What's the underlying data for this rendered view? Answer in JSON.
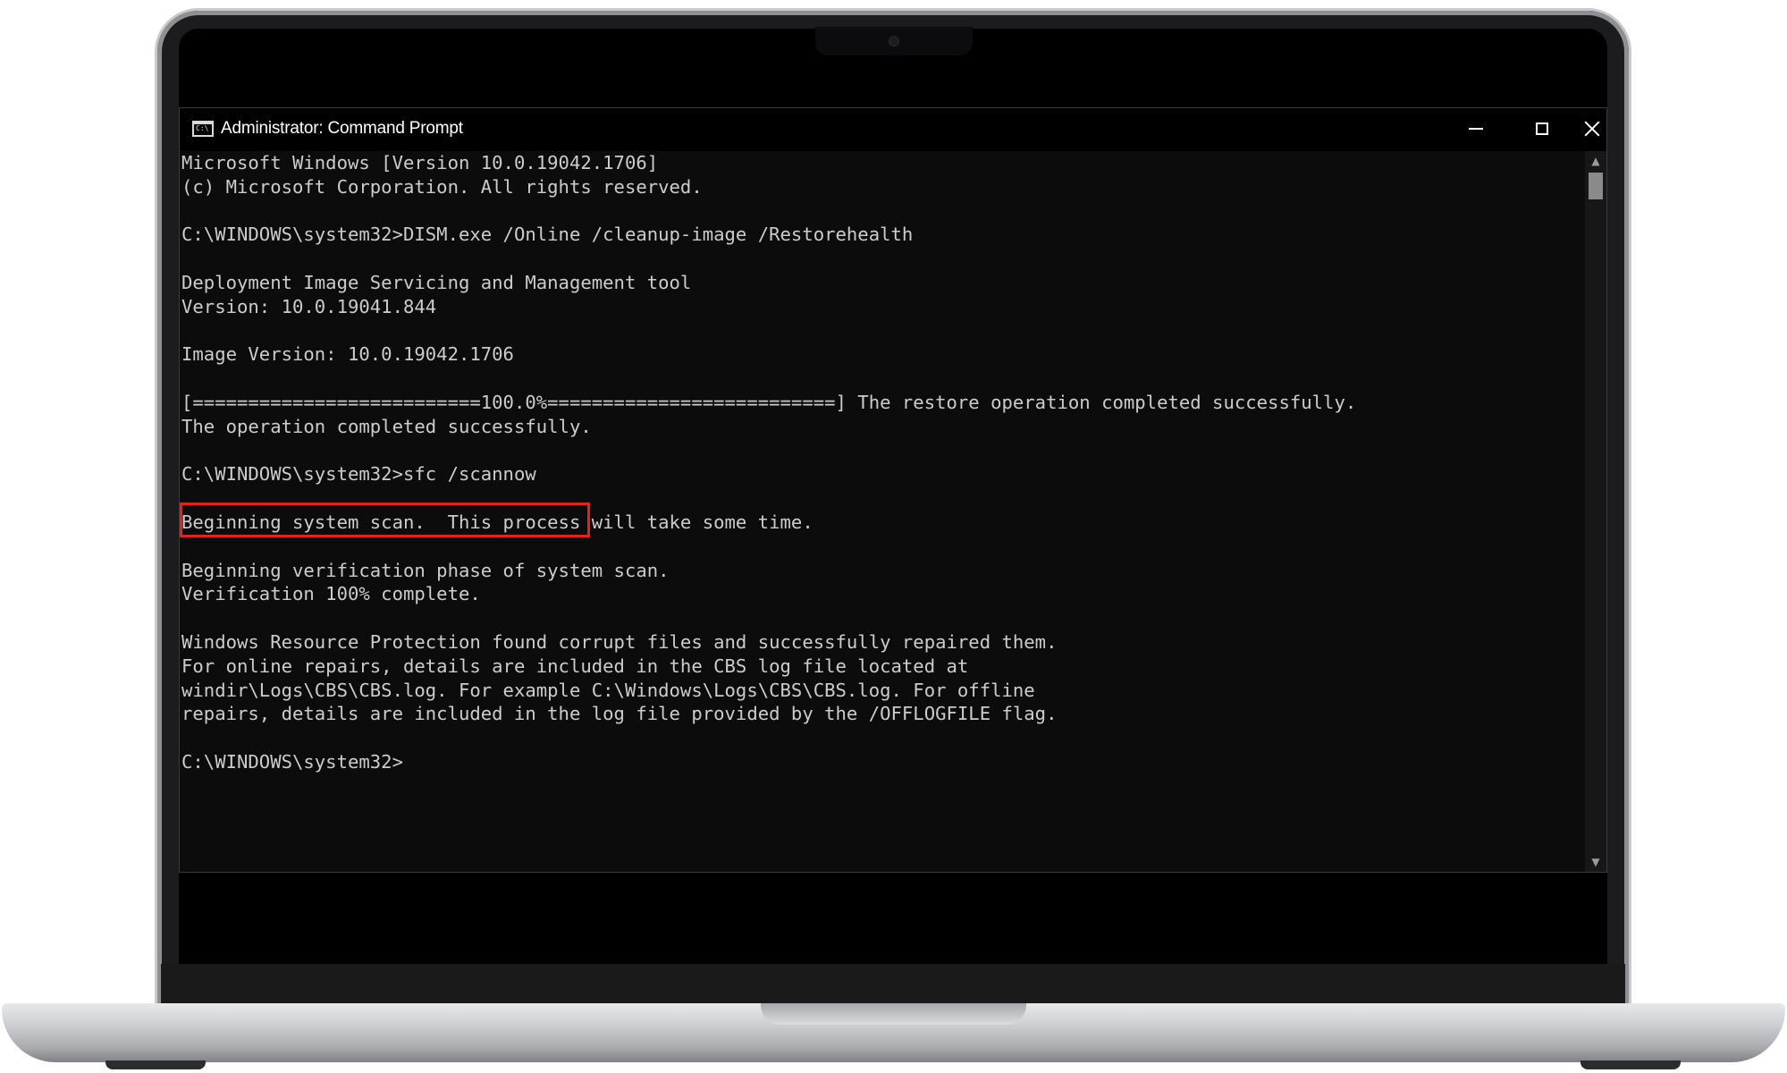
{
  "window": {
    "title": "Administrator: Command Prompt",
    "icon": "cmd-icon",
    "icon_text": "C:\\",
    "controls": {
      "minimize": "minimize-icon",
      "maximize": "maximize-icon",
      "close": "close-icon"
    }
  },
  "console": {
    "lines": [
      "Microsoft Windows [Version 10.0.19042.1706]",
      "(c) Microsoft Corporation. All rights reserved.",
      "",
      "C:\\WINDOWS\\system32>DISM.exe /Online /cleanup-image /Restorehealth",
      "",
      "Deployment Image Servicing and Management tool",
      "Version: 10.0.19041.844",
      "",
      "Image Version: 10.0.19042.1706",
      "",
      "[==========================100.0%==========================] The restore operation completed successfully.",
      "The operation completed successfully.",
      "",
      "C:\\WINDOWS\\system32>sfc /scannow",
      "",
      "Beginning system scan.  This process will take some time.",
      "",
      "Beginning verification phase of system scan.",
      "Verification 100% complete.",
      "",
      "Windows Resource Protection found corrupt files and successfully repaired them.",
      "For online repairs, details are included in the CBS log file located at",
      "windir\\Logs\\CBS\\CBS.log. For example C:\\Windows\\Logs\\CBS\\CBS.log. For offline",
      "repairs, details are included in the log file provided by the /OFFLOGFILE flag.",
      "",
      "C:\\WINDOWS\\system32>"
    ],
    "highlighted_command": "C:\\WINDOWS\\system32>sfc /scannow"
  },
  "colors": {
    "console_background": "#0c0c0c",
    "console_text": "#cccccc",
    "highlight_border": "#e02418"
  },
  "scrollbar": {
    "up_arrow": "chevron-up-icon",
    "down_arrow": "chevron-down-icon"
  }
}
